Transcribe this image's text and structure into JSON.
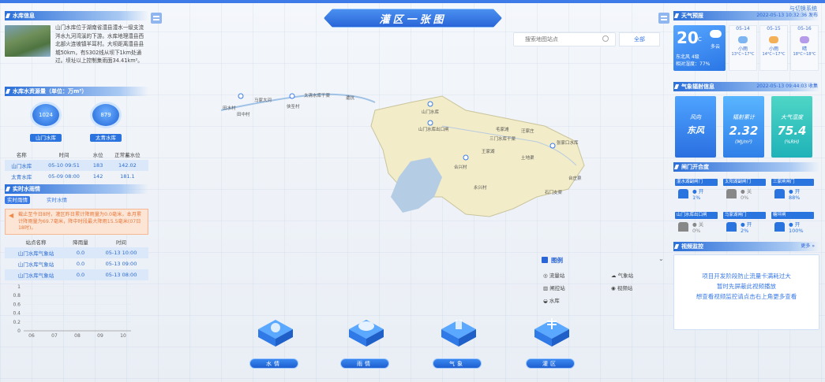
{
  "header": {
    "title": "灌区一张图",
    "switch_label": "与切换系统"
  },
  "left": {
    "reservoir_info": {
      "title": "水库信息",
      "text": "山门水库位于湖南省澧县澧水一级支流涔水九河湾溪的下游。水库地理澧县西北部火连坡镇羊耳村。大坝距离澧县县城50km，有S302线从坝下1km处通过。坝址以上控制集雨面34.41km²。"
    },
    "storage": {
      "title": "水库水资源量（单位：万m³）",
      "items": [
        {
          "value": "1024",
          "label": "山门水库"
        },
        {
          "value": "879",
          "label": "太青水库"
        }
      ]
    },
    "water_table": {
      "headers": [
        "名称",
        "时间",
        "水位",
        "正常蓄水位"
      ],
      "rows": [
        [
          "山门水库",
          "05-10 09:51",
          "183",
          "142.02"
        ],
        [
          "太青水库",
          "05-09 08:00",
          "142",
          "181.1"
        ]
      ]
    },
    "rain": {
      "title": "实时水雨情",
      "tabs": [
        "实时雨情",
        "实时水情"
      ],
      "alert": "截止至今日8时，灌区昨日累计降雨量为0.0毫米，本月累计降雨量为69.7毫米，降中时段最大降雨15.5毫米(07日18时)。",
      "headers": [
        "站点名称",
        "降雨量",
        "时间"
      ],
      "rows": [
        [
          "山门水库气象站",
          "0.0",
          "05-13 10:00"
        ],
        [
          "山门水库气象站",
          "0.0",
          "05-13 09:00"
        ],
        [
          "山门水库气象站",
          "0.0",
          "05-13 08:00"
        ]
      ]
    }
  },
  "chart_data": {
    "type": "line",
    "categories": [
      "06",
      "07",
      "08",
      "09",
      "10"
    ],
    "y_ticks": [
      "0",
      "0.2",
      "0.4",
      "0.6",
      "0.8",
      "1"
    ],
    "ylim": [
      0,
      1
    ],
    "series": [
      {
        "values": []
      }
    ]
  },
  "search": {
    "placeholder": "搜索地图站点",
    "all_label": "全部"
  },
  "legend": {
    "title": "图例",
    "items": [
      "流量站",
      "气象站",
      "闸控站",
      "视频站",
      "水库"
    ]
  },
  "tiles": [
    "水情",
    "雨情",
    "气象",
    "灌区"
  ],
  "map_labels": [
    "田水村",
    "田中村",
    "马家大河",
    "侠圣村",
    "太清水库干渠",
    "遭抗",
    "山门水库",
    "山门水库出口闸",
    "三门水库干渠",
    "毛家滩",
    "汪家庄",
    "合兴村",
    "王家湖",
    "中二支渠",
    "黄岗渠",
    "张家口水库",
    "九冠渠",
    "土地渠",
    "永丰分",
    "永兴村",
    "双河",
    "干底支渠",
    "和平口",
    "湖山",
    "石门支渠",
    "凹泉",
    "台庄泉",
    "四门支渠"
  ],
  "right": {
    "weather": {
      "title": "天气预报",
      "time": "2022-05-13 10:32:36 发布",
      "temp": "20",
      "unit": "℃",
      "cond": "多云",
      "wind": "东北风 4级",
      "humidity": "相对湿度：77%",
      "days": [
        {
          "date": "05-14",
          "cond": "小雨",
          "range": "13°C~17°C"
        },
        {
          "date": "05-15",
          "cond": "小雨",
          "range": "14°C~17°C"
        },
        {
          "date": "05-16",
          "cond": "晴",
          "range": "18°C~18°C"
        }
      ]
    },
    "met": {
      "title": "气象辐射信息",
      "time": "2022-05-13 09:44:03 收集",
      "cards": [
        {
          "label": "风向",
          "value": "东风",
          "unit": ""
        },
        {
          "label": "辐射累计",
          "value": "2.32",
          "unit": "(MJ/m²)"
        },
        {
          "label": "大气湿度",
          "value": "75.4",
          "unit": "(%RH)"
        }
      ]
    },
    "gates": {
      "title": "闸门开合度",
      "items": [
        {
          "name": "混水湖副闸门",
          "state": "● 开",
          "pct": "1%"
        },
        {
          "name": "太阳湖副闸门",
          "state": "● 关",
          "pct": "0%"
        },
        {
          "name": "三家闸闸门",
          "state": "● 开",
          "pct": "88%"
        },
        {
          "name": "山门水库出口闸",
          "state": "● 关",
          "pct": "0%"
        },
        {
          "name": "马家湖闸门",
          "state": "● 开",
          "pct": "2%"
        },
        {
          "name": "糖坪闸",
          "state": "● 开",
          "pct": "100%"
        }
      ]
    },
    "video": {
      "title": "视频监控",
      "more": "更多 »",
      "message": [
        "项目开发阶段防止流量卡满耗过大",
        "暂时先屏蔽此视频播放",
        "想查看视频监控请点击右上角更多查看"
      ]
    }
  },
  "colors": {
    "primary": "#2a74e0",
    "alert_bg": "#fde5d6",
    "gate_open": "#2a74e0",
    "gate_closed": "#888888"
  }
}
